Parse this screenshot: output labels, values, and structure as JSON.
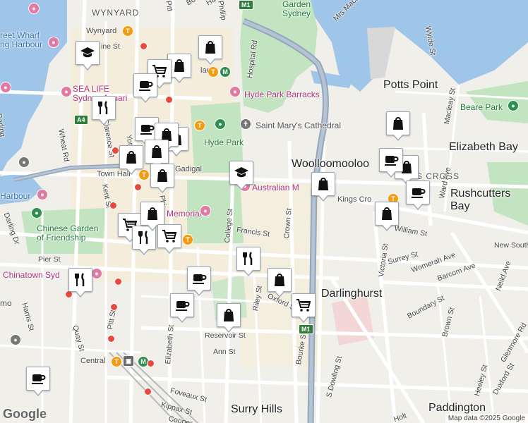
{
  "map": {
    "suburbs": {
      "wynyard": "WYNYARD",
      "potts_point": "Potts Point",
      "woolloomooloo": "Woolloomooloo",
      "elizabeth_bay": "Elizabeth Bay",
      "rushcutters_bay": "Rushcutters\nBay",
      "darlinghurst": "Darlinghurst",
      "surry_hills": "Surry Hills",
      "paddington": "Paddington",
      "hyde_park": "Hyde Park",
      "kings_cross": "Kings Cro",
      "s_cross": "S CROSS"
    },
    "places": {
      "garden_sydney": "Garden\nSydney",
      "hyde_park_barracks": "Hyde Park Barracks",
      "st_marys": "Saint Mary's Cathedral",
      "australian_museum": "Australian M",
      "sea_life": "SEA LIFE\nSydney Aquari",
      "chinese_garden": "Chinese Garden\nof Friendship",
      "chinatown": "Chinatown Syd",
      "beare_park": "Beare Park",
      "memorial": "Memorial",
      "street_wharf": "reet Wharf\nng Harbour",
      "harbour": "Harbour",
      "town_hall": "Town Hall",
      "gadigal": "Gadigal",
      "wynyard_station": "Wynyard",
      "central": "Central",
      "mo": "mo",
      "place": "lace"
    },
    "streets": [
      "Mrs Macquaries Rd",
      "Hospital Rd",
      "Macleay St",
      "Wylde St",
      "Ward Ave",
      "Victoria St",
      "William St",
      "New South",
      "Neild Ave",
      "Womerah Ave",
      "Barcom Ave",
      "Surrey St",
      "Boundary St",
      "Brown St",
      "Glenmore Rd",
      "Heeley St",
      "Duxford St",
      "Oxford St",
      "Crown St",
      "Riley St",
      "Bourke St",
      "S Dowling St",
      "College St",
      "Francis St",
      "Reservoir St",
      "Ann St",
      "Foveaux St",
      "Kippax St",
      "Cooper",
      "Elizabeth St",
      "Pitt St",
      "Quay St",
      "Harris St",
      "Pier St",
      "Darling Dr",
      "Kent St",
      "Clarence St",
      "Wheat Rd",
      "Phillip",
      "Pitt",
      "Ha",
      "Bo",
      "York",
      "Phi",
      "ine St",
      "Darling",
      "Holt"
    ],
    "road_shields": [
      "M1",
      "M1",
      "A4"
    ],
    "google": "Google",
    "attribution": "Map data ©2025 Google"
  },
  "markers": [
    {
      "type": "shopping-bag"
    },
    {
      "type": "shopping-bag"
    },
    {
      "type": "shopping-cart"
    },
    {
      "type": "school"
    },
    {
      "type": "cafe"
    },
    {
      "type": "restaurant"
    },
    {
      "type": "cafe"
    },
    {
      "type": "shopping-bag"
    },
    {
      "type": "shopping-bag"
    },
    {
      "type": "shopping-bag"
    },
    {
      "type": "shopping-bag"
    },
    {
      "type": "school"
    },
    {
      "type": "shopping-bag"
    },
    {
      "type": "shopping-bag"
    },
    {
      "type": "shopping-cart"
    },
    {
      "type": "restaurant"
    },
    {
      "type": "shopping-bag"
    },
    {
      "type": "shopping-cart"
    },
    {
      "type": "restaurant"
    },
    {
      "type": "restaurant"
    },
    {
      "type": "cafe"
    },
    {
      "type": "cafe"
    },
    {
      "type": "shopping-bag"
    },
    {
      "type": "shopping-bag"
    },
    {
      "type": "shopping-cart"
    },
    {
      "type": "cafe"
    },
    {
      "type": "shopping-bag"
    },
    {
      "type": "shopping-bag"
    },
    {
      "type": "cafe"
    },
    {
      "type": "shopping-bag"
    },
    {
      "type": "cafe"
    }
  ],
  "colors": {
    "water": "#9fc5e8",
    "park": "#c3e4c0",
    "land": "#f1efea",
    "motorway": "#93a6bd",
    "road": "#ffffff",
    "marker_icon": "#111111"
  }
}
